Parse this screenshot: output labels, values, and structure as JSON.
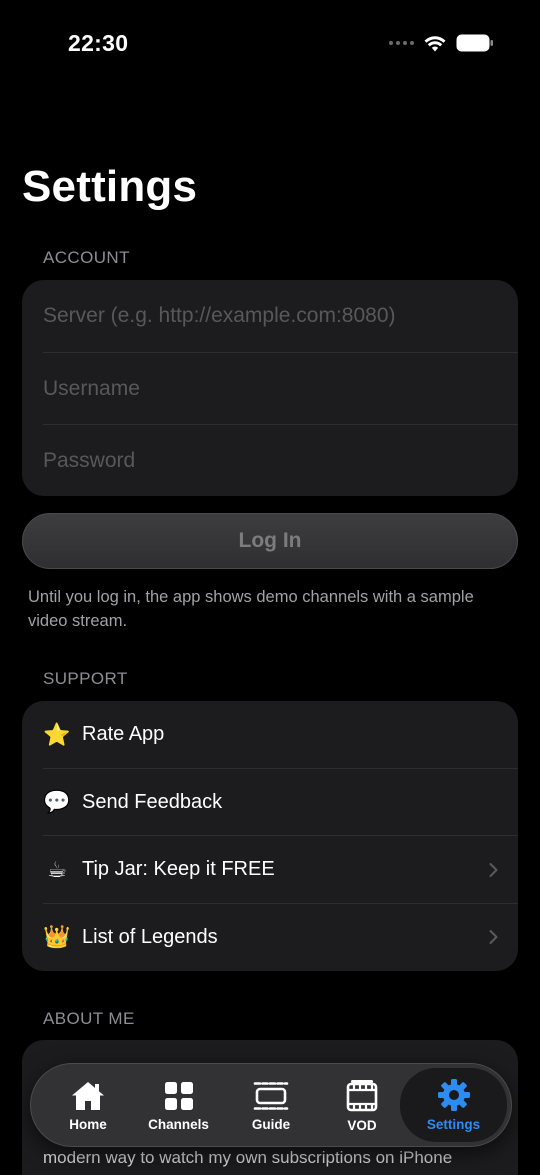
{
  "status": {
    "time": "22:30"
  },
  "page": {
    "title": "Settings"
  },
  "account": {
    "header": "ACCOUNT",
    "server_placeholder": "Server (e.g. http://example.com:8080)",
    "username_placeholder": "Username",
    "password_placeholder": "Password",
    "login_label": "Log In",
    "helper": "Until you log in, the app shows demo channels with a sample video stream."
  },
  "support": {
    "header": "SUPPORT",
    "items": [
      {
        "emoji": "⭐",
        "label": "Rate App"
      },
      {
        "emoji": "💬",
        "label": "Send Feedback"
      },
      {
        "emoji": "☕",
        "label": "Tip Jar: Keep it FREE"
      },
      {
        "emoji": "👑",
        "label": "List of Legends"
      }
    ]
  },
  "about": {
    "header": "ABOUT ME",
    "text": "modern way to watch my own subscriptions on iPhone"
  },
  "tabs": [
    {
      "label": "Home",
      "icon": "home-icon"
    },
    {
      "label": "Channels",
      "icon": "grid-icon"
    },
    {
      "label": "Guide",
      "icon": "guide-icon"
    },
    {
      "label": "VOD",
      "icon": "film-icon"
    },
    {
      "label": "Settings",
      "icon": "gear-icon"
    }
  ],
  "colors": {
    "accent": "#2d8cf0",
    "background": "#000000",
    "card": "#1c1c1e"
  }
}
